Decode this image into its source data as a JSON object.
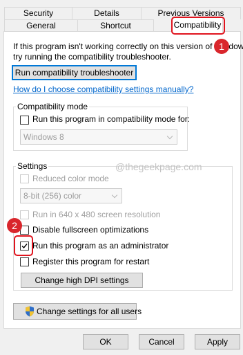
{
  "tabs": {
    "security": "Security",
    "details": "Details",
    "previous_versions": "Previous Versions",
    "general": "General",
    "shortcut": "Shortcut",
    "compatibility": "Compatibility"
  },
  "intro_text_line1": "If this program isn't working correctly on this version of Windows,",
  "intro_text_line2": "try running the compatibility troubleshooter.",
  "troubleshooter_button": "Run compatibility troubleshooter",
  "help_link": "How do I choose compatibility settings manually?",
  "compatibility_mode": {
    "title": "Compatibility mode",
    "checkbox_label": "Run this program in compatibility mode for:",
    "checked": false,
    "selected_os": "Windows 8"
  },
  "settings": {
    "title": "Settings",
    "reduced_color": {
      "label": "Reduced color mode",
      "checked": false,
      "enabled": false
    },
    "color_select": "8-bit (256) color",
    "run_640": {
      "label": "Run in 640 x 480 screen resolution",
      "checked": false,
      "enabled": false
    },
    "disable_fullscreen": {
      "label": "Disable fullscreen optimizations",
      "checked": false
    },
    "run_as_admin": {
      "label": "Run this program as an administrator",
      "checked": true
    },
    "register_restart": {
      "label": "Register this program for restart",
      "checked": false
    },
    "dpi_button": "Change high DPI settings"
  },
  "all_users_button": "Change settings for all users",
  "footer": {
    "ok": "OK",
    "cancel": "Cancel",
    "apply": "Apply"
  },
  "watermark": "@thegeekpage.com",
  "annotations": {
    "badge1": "1",
    "badge2": "2"
  },
  "colors": {
    "accent": "#0078d7",
    "highlight": "#e0141e",
    "link": "#0066cc"
  }
}
